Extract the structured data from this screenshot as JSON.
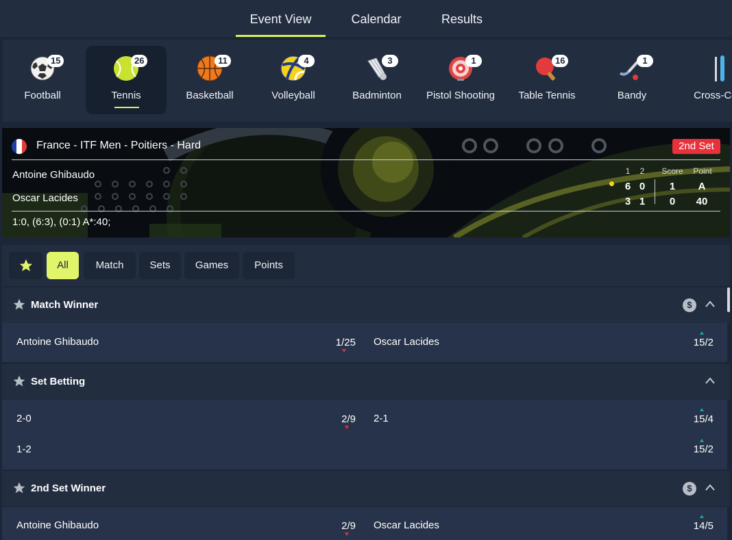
{
  "topnav": {
    "tabs": [
      {
        "label": "Event View",
        "active": true
      },
      {
        "label": "Calendar",
        "active": false
      },
      {
        "label": "Results",
        "active": false
      }
    ]
  },
  "sports": [
    {
      "label": "Football",
      "count": "15",
      "icon": "soccer-ball-icon"
    },
    {
      "label": "Tennis",
      "count": "26",
      "icon": "tennis-ball-icon",
      "active": true
    },
    {
      "label": "Basketball",
      "count": "11",
      "icon": "basketball-icon"
    },
    {
      "label": "Volleyball",
      "count": "4",
      "icon": "volleyball-icon"
    },
    {
      "label": "Badminton",
      "count": "3",
      "icon": "shuttlecock-icon"
    },
    {
      "label": "Pistol Shooting",
      "count": "1",
      "icon": "target-icon"
    },
    {
      "label": "Table Tennis",
      "count": "16",
      "icon": "ping-pong-paddle-icon"
    },
    {
      "label": "Bandy",
      "count": "1",
      "icon": "bandy-stick-icon"
    },
    {
      "label": "Cross-Cou",
      "count": "",
      "icon": "ski-icon"
    }
  ],
  "event": {
    "league": "France - ITF Men - Poitiers - Hard",
    "status": "2nd Set",
    "players": [
      "Antoine Ghibaudo",
      "Oscar Lacides"
    ],
    "headers": {
      "set1": "1",
      "set2": "2",
      "score": "Score",
      "point": "Point"
    },
    "p1": {
      "set1": "6",
      "set2": "0",
      "score": "1",
      "point": "A"
    },
    "p2": {
      "set1": "3",
      "set2": "1",
      "score": "0",
      "point": "40"
    },
    "summary": "1:0, (6:3), (0:1) A*:40;"
  },
  "filters": [
    "All",
    "Match",
    "Sets",
    "Games",
    "Points"
  ],
  "markets": {
    "match_winner": {
      "title": "Match Winner",
      "sel": [
        {
          "name": "Antoine Ghibaudo",
          "odd": "1/25",
          "trend": "down"
        },
        {
          "name": "Oscar Lacides",
          "odd": "15/2",
          "trend": "up"
        }
      ]
    },
    "set_betting": {
      "title": "Set Betting",
      "sel": [
        {
          "name": "2-0",
          "odd": "2/9",
          "trend": "down"
        },
        {
          "name": "2-1",
          "odd": "15/4",
          "trend": "up"
        },
        {
          "name": "1-2",
          "odd": "15/2",
          "trend": "up"
        }
      ]
    },
    "second_set_winner": {
      "title": "2nd Set Winner",
      "sel": [
        {
          "name": "Antoine Ghibaudo",
          "odd": "2/9",
          "trend": "down"
        },
        {
          "name": "Oscar Lacides",
          "odd": "14/5",
          "trend": "up"
        }
      ]
    }
  },
  "symbols": {
    "dollar": "$"
  },
  "colors": {
    "accent": "#d6f25a",
    "live_badge": "#e8313b",
    "odds_up": "#16a89a",
    "odds_down": "#e0313f"
  }
}
